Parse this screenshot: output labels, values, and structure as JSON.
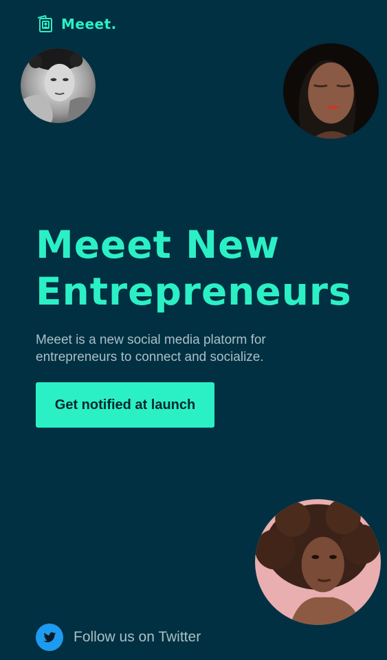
{
  "brand": {
    "name": "Meeet.",
    "logo_icon": "photo-frame-logo-icon"
  },
  "hero": {
    "headline": "Meeet New Entrepreneurs",
    "description": "Meeet is a new social media platorm for entrepreneurs to connect and socialize.",
    "cta_label": "Get notified at launch"
  },
  "social": {
    "icon": "twitter-bird-icon",
    "label": "Follow us on Twitter"
  },
  "colors": {
    "background": "#003041",
    "accent": "#2cf0c5",
    "muted_text": "#a9c0c8",
    "twitter_blue": "#1d9bf0"
  },
  "avatars": [
    {
      "name": "avatar-man-curly-hair",
      "style": "black-and-white portrait"
    },
    {
      "name": "avatar-woman-eyes-closed",
      "style": "dark portrait"
    },
    {
      "name": "avatar-woman-afro",
      "style": "pink background portrait"
    }
  ]
}
